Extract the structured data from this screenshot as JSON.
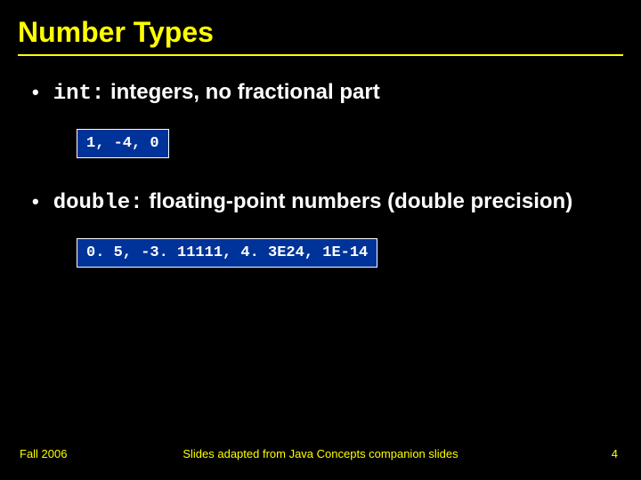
{
  "title": "Number Types",
  "bullets": [
    {
      "code_prefix": "int:",
      "text": " integers, no fractional part",
      "codebox": "1, -4, 0"
    },
    {
      "code_prefix": "double:",
      "text": " floating-point numbers (double precision)",
      "codebox": "0. 5, -3. 11111, 4. 3E24, 1E-14"
    }
  ],
  "footer": {
    "left": "Fall 2006",
    "center": "Slides adapted from Java Concepts companion slides",
    "right": "4"
  }
}
